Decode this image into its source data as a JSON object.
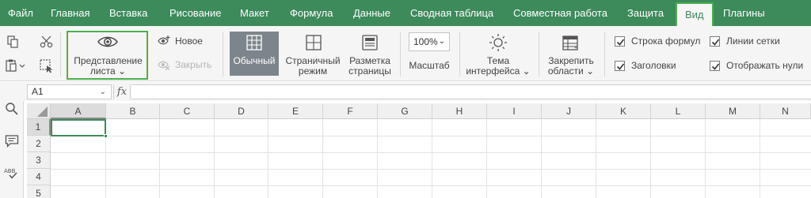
{
  "menu": [
    {
      "label": "Файл"
    },
    {
      "label": "Главная"
    },
    {
      "label": "Вставка"
    },
    {
      "label": "Рисование"
    },
    {
      "label": "Макет"
    },
    {
      "label": "Формула"
    },
    {
      "label": "Данные"
    },
    {
      "label": "Сводная таблица"
    },
    {
      "label": "Совместная работа"
    },
    {
      "label": "Защита"
    },
    {
      "label": "Вид",
      "active": true
    },
    {
      "label": "Плагины"
    }
  ],
  "ribbon": {
    "sheet_view_line1": "Представление",
    "sheet_view_line2": "листа",
    "new_label": "Новое",
    "close_label": "Закрыть",
    "normal_label": "Обычный",
    "page_mode_line1": "Страничный",
    "page_mode_line2": "режим",
    "page_layout_line1": "Разметка",
    "page_layout_line2": "страницы",
    "zoom_value": "100%",
    "zoom_label": "Масштаб",
    "theme_line1": "Тема",
    "theme_line2": "интерфейса",
    "freeze_line1": "Закрепить",
    "freeze_line2": "области",
    "checkboxes": {
      "formula_bar": {
        "label": "Строка формул",
        "checked": true
      },
      "headings": {
        "label": "Заголовки",
        "checked": true
      },
      "gridlines": {
        "label": "Линии сетки",
        "checked": true
      },
      "show_zeros": {
        "label": "Отображать нули",
        "checked": true
      }
    }
  },
  "formula_bar": {
    "cell_ref": "A1",
    "fx": "fx",
    "value": ""
  },
  "grid": {
    "columns": [
      "A",
      "B",
      "C",
      "D",
      "E",
      "F",
      "G",
      "H",
      "I",
      "J",
      "K",
      "L",
      "M",
      "N"
    ],
    "rows": [
      "1",
      "2",
      "3",
      "4",
      "5"
    ],
    "active_cell": "A1"
  },
  "colors": {
    "accent": "#3d8a5b",
    "highlight": "#4caf50"
  }
}
